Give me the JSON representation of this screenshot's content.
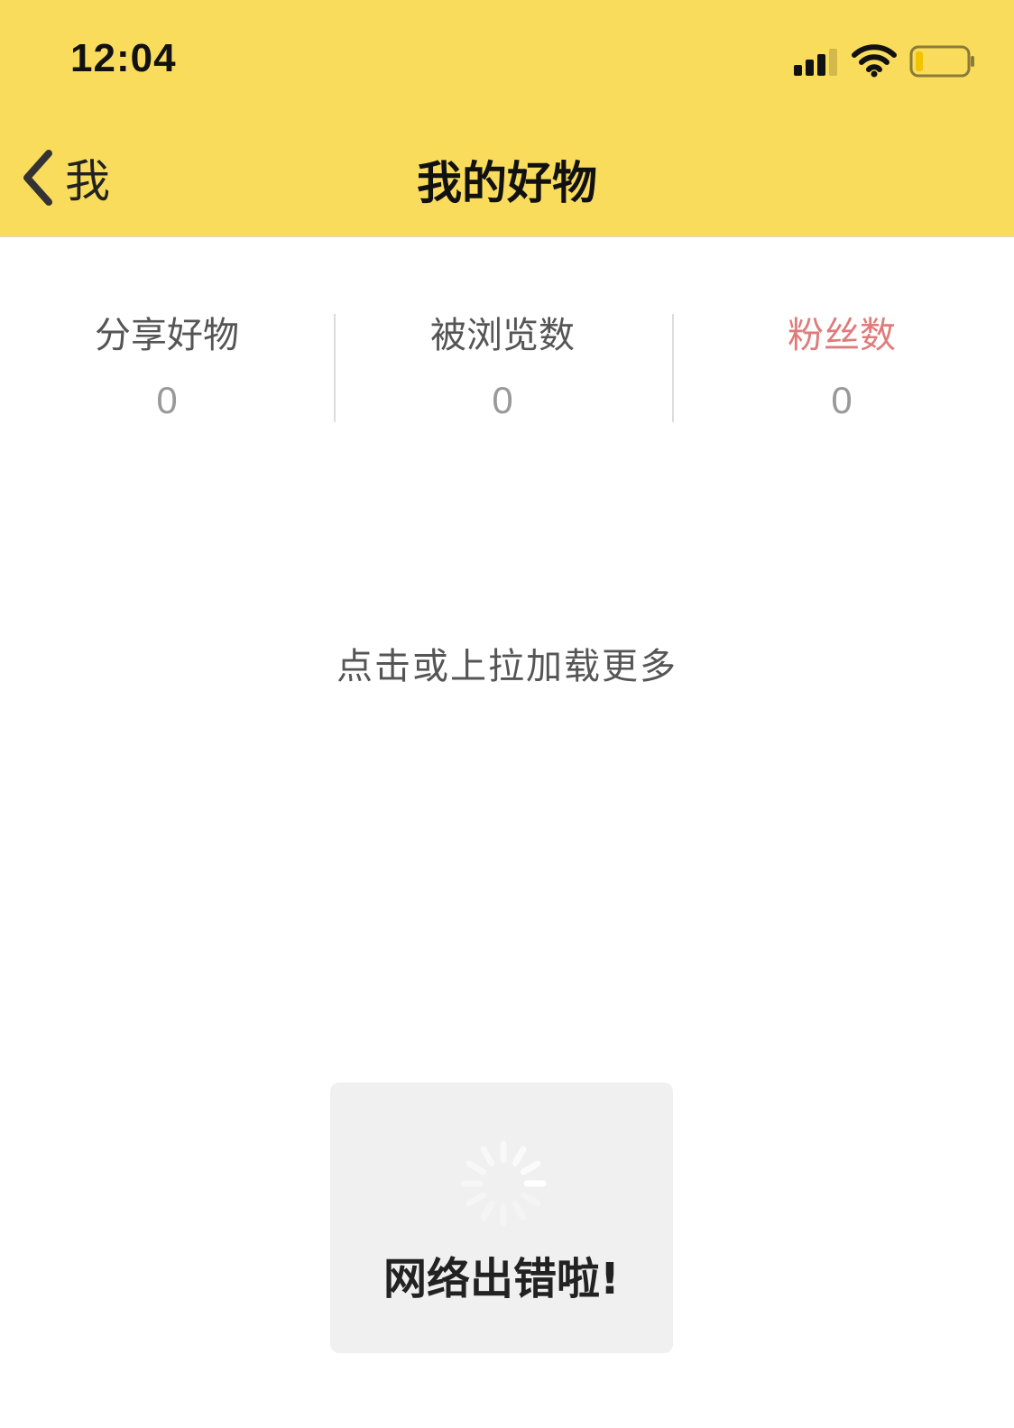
{
  "status_bar": {
    "time": "12:04",
    "icons": [
      "cellular-signal-icon",
      "wifi-icon",
      "battery-icon"
    ]
  },
  "nav": {
    "back_label": "我",
    "title": "我的好物"
  },
  "stats": [
    {
      "label": "分享好物",
      "value": "0"
    },
    {
      "label": "被浏览数",
      "value": "0"
    },
    {
      "label": "粉丝数",
      "value": "0"
    }
  ],
  "load_more": "点击或上拉加载更多",
  "toast": {
    "message": "网络出错啦!",
    "icon": "loading-spinner-icon"
  },
  "colors": {
    "header_bg": "#f9dc5c",
    "active_stat": "#e07b7b",
    "toast_bg": "#f0f0f1"
  }
}
